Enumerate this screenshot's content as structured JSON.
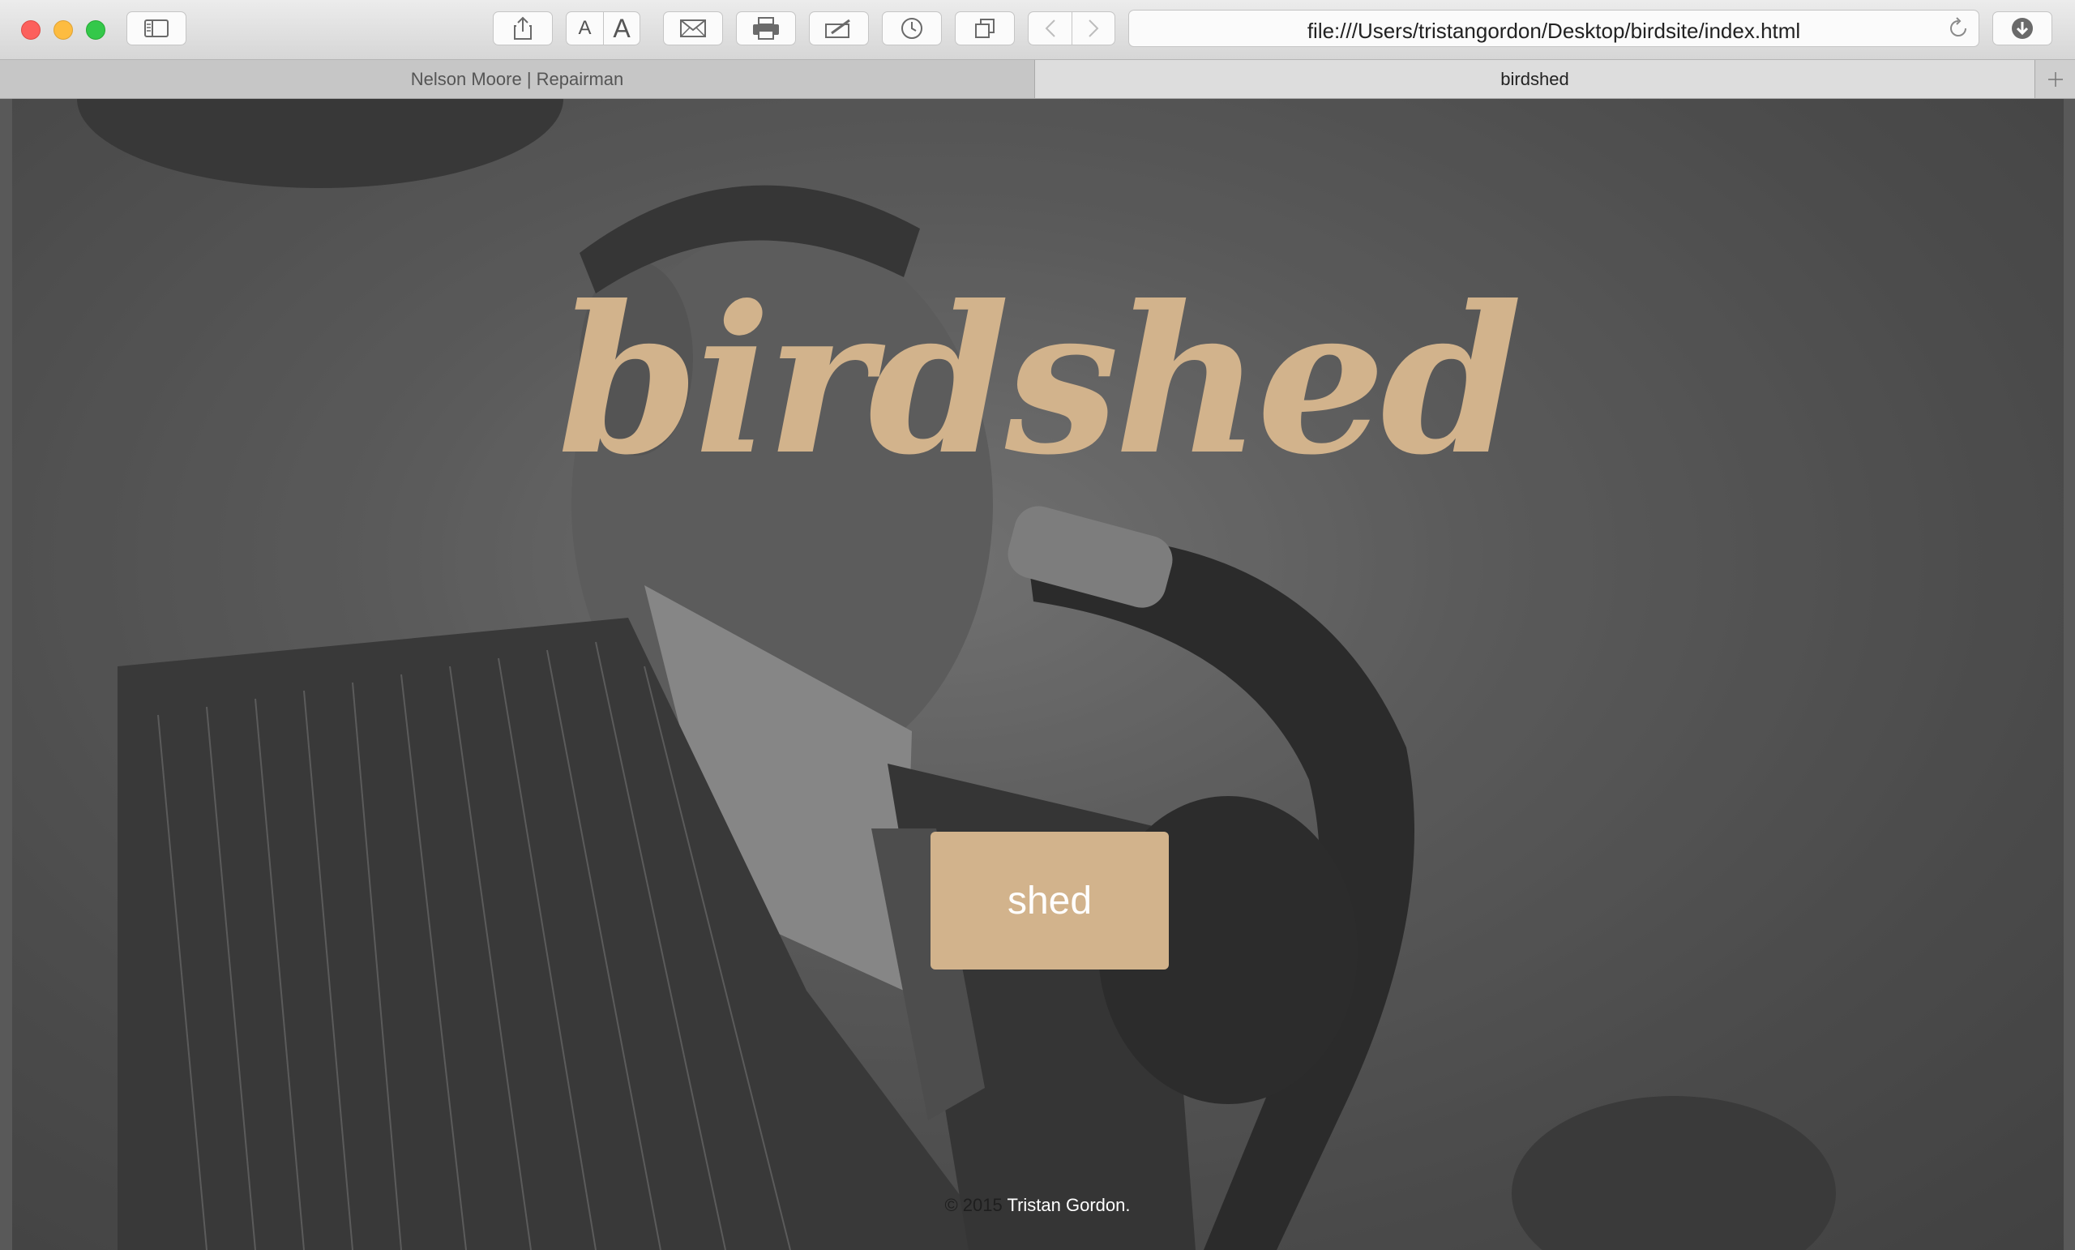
{
  "browser": {
    "url": "file:///Users/tristangordon/Desktop/birdsite/index.html",
    "tabs": [
      {
        "label": "Nelson Moore | Repairman",
        "active": false
      },
      {
        "label": "birdshed",
        "active": true
      }
    ],
    "toolbar_icons": [
      "sidebar-icon",
      "share-icon",
      "font-smaller-icon",
      "font-larger-icon",
      "mail-icon",
      "print-icon",
      "annotate-icon",
      "history-icon",
      "tabs-icon",
      "back-icon",
      "forward-icon",
      "reload-icon",
      "downloads-icon"
    ],
    "font_small_label": "A",
    "font_large_label": "A"
  },
  "page": {
    "title": "birdshed",
    "button_label": "shed",
    "footer_copyright": "© 2015",
    "footer_name": "Tristan Gordon."
  },
  "colors": {
    "accent": "#d2b38c",
    "button_text": "#ffffff"
  }
}
